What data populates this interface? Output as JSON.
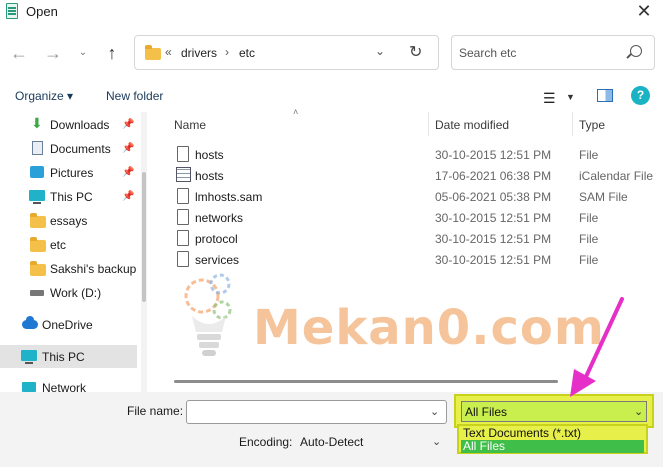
{
  "window": {
    "title": "Open",
    "close_glyph": "✕"
  },
  "nav": {
    "back": "←",
    "forward": "→",
    "recent": "⌄",
    "up": "↑",
    "refresh": "↻"
  },
  "address": {
    "prefix": "«",
    "crumbs": [
      "drivers",
      "etc"
    ],
    "separator": "›",
    "dropdown": "⌄"
  },
  "search": {
    "placeholder": "Search etc"
  },
  "commandbar": {
    "organize": "Organize ▾",
    "new_folder": "New folder",
    "view_glyph": "☰",
    "view_drop": "▼",
    "help": "?"
  },
  "sidebar": {
    "items": [
      {
        "label": "Downloads",
        "icon": "download-icon",
        "pinned": true
      },
      {
        "label": "Documents",
        "icon": "document-icon",
        "pinned": true
      },
      {
        "label": "Pictures",
        "icon": "picture-icon",
        "pinned": true
      },
      {
        "label": "This PC",
        "icon": "computer-icon",
        "pinned": true
      },
      {
        "label": "essays",
        "icon": "folder-icon",
        "pinned": false
      },
      {
        "label": "etc",
        "icon": "folder-icon",
        "pinned": false
      },
      {
        "label": "Sakshi's backup",
        "icon": "folder-icon",
        "pinned": false
      },
      {
        "label": "Work (D:)",
        "icon": "drive-icon",
        "pinned": false
      },
      {
        "label": "OneDrive",
        "icon": "cloud-icon",
        "pinned": false
      },
      {
        "label": "This PC",
        "icon": "computer-icon",
        "pinned": false,
        "selected": true
      },
      {
        "label": "Network",
        "icon": "network-icon",
        "pinned": false
      }
    ],
    "pin_glyph": "📌"
  },
  "files": {
    "columns": {
      "name": "Name",
      "date": "Date modified",
      "type": "Type"
    },
    "sort_glyph": "˄",
    "rows": [
      {
        "name": "hosts",
        "date": "30-10-2015 12:51 PM",
        "type": "File",
        "icon": "file-icon"
      },
      {
        "name": "hosts",
        "date": "17-06-2021 06:38 PM",
        "type": "iCalendar File",
        "icon": "calendar-icon"
      },
      {
        "name": "lmhosts.sam",
        "date": "05-06-2021 05:38 PM",
        "type": "SAM File",
        "icon": "file-icon"
      },
      {
        "name": "networks",
        "date": "30-10-2015 12:51 PM",
        "type": "File",
        "icon": "file-icon"
      },
      {
        "name": "protocol",
        "date": "30-10-2015 12:51 PM",
        "type": "File",
        "icon": "file-icon"
      },
      {
        "name": "services",
        "date": "30-10-2015 12:51 PM",
        "type": "File",
        "icon": "file-icon"
      }
    ]
  },
  "watermark": {
    "text": "Mekan0.com"
  },
  "footer": {
    "file_name_label": "File name:",
    "file_name_value": "",
    "encoding_label": "Encoding:",
    "encoding_value": "Auto-Detect",
    "type_value": "All Files",
    "type_options": [
      "Text Documents (*.txt)",
      "All Files"
    ],
    "chevron": "⌄"
  },
  "colors": {
    "highlight": "#e7ef4a",
    "selected_option": "#3fbf4a",
    "arrow": "#e62ec8",
    "watermark": "#f6c49a"
  }
}
